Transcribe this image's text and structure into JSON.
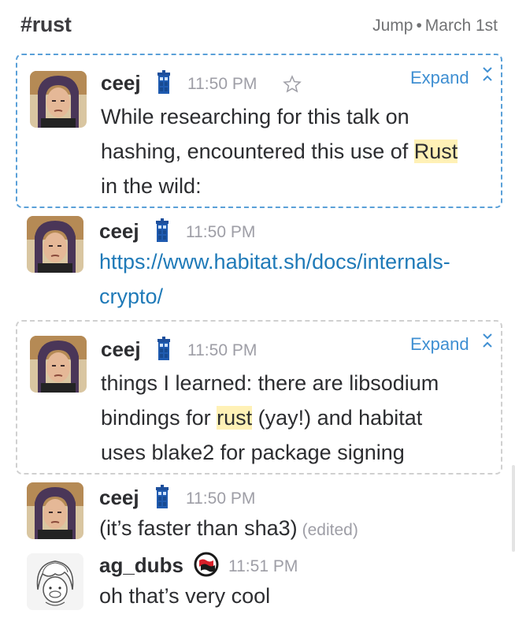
{
  "header": {
    "channel": "#rust",
    "jump": "Jump",
    "date": "March 1st"
  },
  "messages": [
    {
      "author": "ceej",
      "time": "11:50 PM",
      "expand": "Expand",
      "line1_a": "While researching for this talk on",
      "line2_a": "hashing, encountered this use of ",
      "line2_hl": "Rust",
      "line3_a": "in the wild:"
    },
    {
      "author": "ceej",
      "time": "11:50 PM",
      "link1": "https://www.habitat.sh/docs/internals-",
      "link2": "crypto/"
    },
    {
      "author": "ceej",
      "time": "11:50 PM",
      "expand": "Expand",
      "line1_a": "things I learned: there are libsodium",
      "line2_a": "bindings for ",
      "line2_hl": "rust",
      "line2_b": " (yay!) and habitat",
      "line3_a": "uses blake2 for package signing"
    },
    {
      "author": "ceej",
      "time": "11:50 PM",
      "text": "(it’s faster than sha3)",
      "edited": "(edited)"
    },
    {
      "author": "ag_dubs",
      "time": "11:51 PM",
      "text": "oh that’s very cool"
    }
  ],
  "colors": {
    "link": "#1f7ab8",
    "highlight": "#fff1b6",
    "focus_border": "#5aa0d8",
    "timestamp": "#9e9ea6"
  }
}
